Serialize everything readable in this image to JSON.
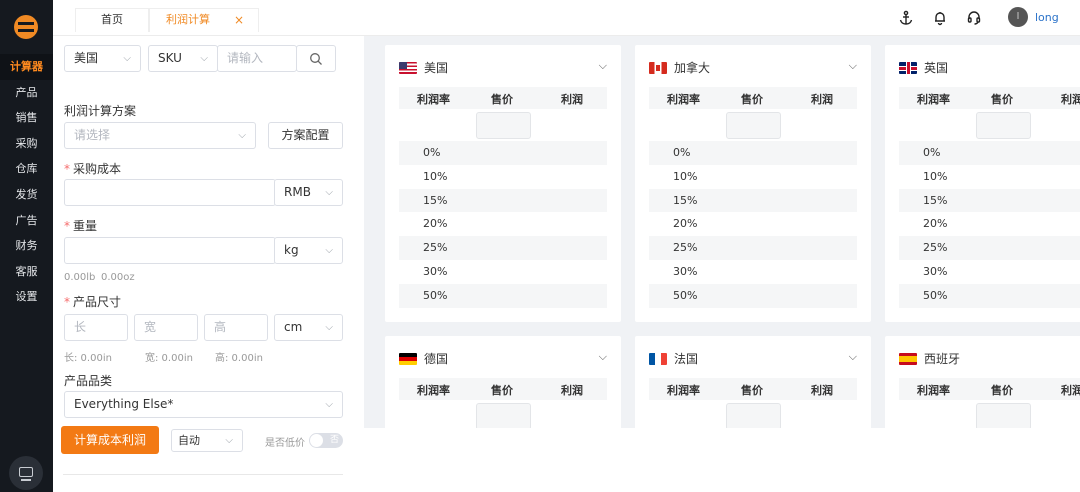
{
  "sidebar": {
    "items": [
      {
        "label": "计算器",
        "active": true
      },
      {
        "label": "产品"
      },
      {
        "label": "销售"
      },
      {
        "label": "采购"
      },
      {
        "label": "仓库"
      },
      {
        "label": "发货"
      },
      {
        "label": "广告"
      },
      {
        "label": "财务"
      },
      {
        "label": "客服"
      },
      {
        "label": "设置"
      }
    ]
  },
  "tabs": [
    {
      "label": "首页"
    },
    {
      "label": "利润计算",
      "active": true,
      "close": "×"
    }
  ],
  "user": {
    "avatar_letter": "l",
    "name": "long"
  },
  "form": {
    "country": "美国",
    "search_type": "SKU",
    "search_placeholder": "请输入",
    "plan_label": "利润计算方案",
    "plan_placeholder": "请选择",
    "plan_button": "方案配置",
    "cost_label": "采购成本",
    "currency": "RMB",
    "weight_label": "重量",
    "weight_unit": "kg",
    "weight_hint_lb": "0.00lb",
    "weight_hint_oz": "0.00oz",
    "size_label": "产品尺寸",
    "size_length_ph": "长",
    "size_width_ph": "宽",
    "size_height_ph": "高",
    "size_unit": "cm",
    "size_hint_length": "长: 0.00in",
    "size_hint_width": "宽: 0.00in",
    "size_hint_height": "高: 0.00in",
    "category_label": "产品品类",
    "category_value": "Everything Else*",
    "calc_button": "计算成本利润",
    "mode": "自动",
    "lowest_label": "是否低价",
    "lowest_switch_text": "否"
  },
  "table_headers": {
    "rate": "利润率",
    "price": "售价",
    "profit": "利润"
  },
  "rates": [
    "0%",
    "10%",
    "15%",
    "20%",
    "25%",
    "30%",
    "50%"
  ],
  "cards": [
    {
      "country": "美国",
      "flag": "us"
    },
    {
      "country": "加拿大",
      "flag": "ca"
    },
    {
      "country": "英国",
      "flag": "gb"
    },
    {
      "country": "德国",
      "flag": "de"
    },
    {
      "country": "法国",
      "flag": "fr"
    },
    {
      "country": "西班牙",
      "flag": "es"
    }
  ],
  "colors": {
    "accent": "#f37a14",
    "sidebar": "#15191f",
    "link": "#2a72c9"
  }
}
